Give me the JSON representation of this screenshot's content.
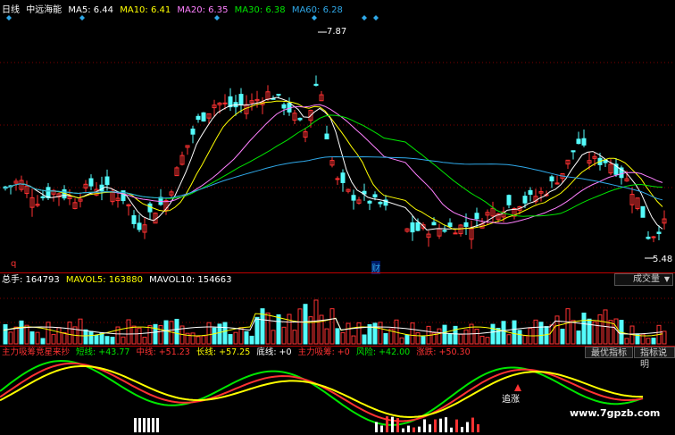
{
  "colors": {
    "up": "#ff3232",
    "down": "#54fcfc",
    "ma5": "#ffffff",
    "ma10": "#ffff00",
    "ma20": "#ff80ff",
    "ma30": "#00e600",
    "ma60": "#2fa8e8",
    "grid": "#800000"
  },
  "price_pane": {
    "period": "日线",
    "stock_name": "中远海能",
    "ma": [
      {
        "label": "MA5: 6.44",
        "color": "#ffffff"
      },
      {
        "label": "MA10: 6.41",
        "color": "#ffff00"
      },
      {
        "label": "MA20: 6.35",
        "color": "#ff80ff"
      },
      {
        "label": "MA30: 6.38",
        "color": "#00e600"
      },
      {
        "label": "MA60: 6.28",
        "color": "#2fa8e8"
      }
    ],
    "high_label": "7.87",
    "low_label": "5.48",
    "marker_q": "q",
    "marker_cai": "财"
  },
  "volume_pane": {
    "items": [
      {
        "label": "总手: 164793",
        "color": "#ffffff"
      },
      {
        "label": "MAVOL5: 163880",
        "color": "#ffff00"
      },
      {
        "label": "MAVOL10: 154663",
        "color": "#ffffff"
      }
    ],
    "indicator_dropdown": "成交量"
  },
  "indicator_pane": {
    "items": [
      {
        "label": "主力吸筹竞星来抄",
        "color": "#ff3232"
      },
      {
        "label": "短线: +43.77",
        "color": "#00e600"
      },
      {
        "label": "中线: +51.23",
        "color": "#ff3232"
      },
      {
        "label": "长线: +57.25",
        "color": "#ffff00"
      },
      {
        "label": "底线: +0",
        "color": "#ffffff"
      },
      {
        "label": "主力吸筹: +0",
        "color": "#ff3232"
      },
      {
        "label": "风险: +42.00",
        "color": "#00e600"
      },
      {
        "label": "涨跌: +50.30",
        "color": "#ff3232"
      }
    ],
    "best_indicator_button": "最优指标",
    "indicator_help_button": "指标说明",
    "chase_label": "追涨"
  },
  "watermark": "www.7gpzb.com"
}
